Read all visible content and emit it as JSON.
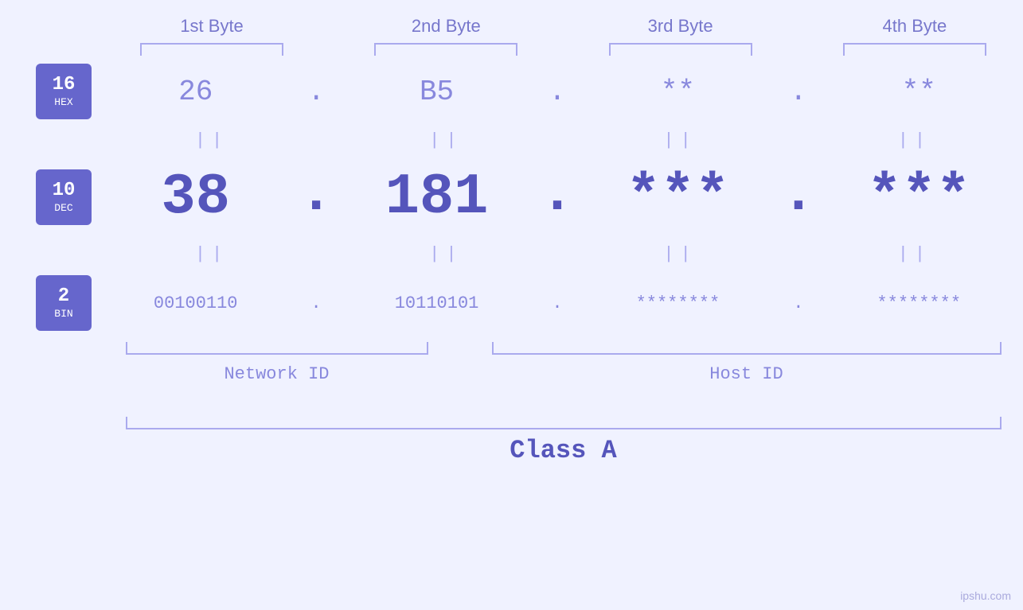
{
  "header": {
    "byte1": "1st Byte",
    "byte2": "2nd Byte",
    "byte3": "3rd Byte",
    "byte4": "4th Byte"
  },
  "badges": {
    "hex": {
      "num": "16",
      "label": "HEX"
    },
    "dec": {
      "num": "10",
      "label": "DEC"
    },
    "bin": {
      "num": "2",
      "label": "BIN"
    }
  },
  "hex_values": {
    "b1": "26",
    "b2": "B5",
    "b3": "**",
    "b4": "**"
  },
  "dec_values": {
    "b1": "38",
    "b2": "181",
    "b3": "***",
    "b4": "***"
  },
  "bin_values": {
    "b1": "00100110",
    "b2": "10110101",
    "b3": "********",
    "b4": "********"
  },
  "labels": {
    "network_id": "Network ID",
    "host_id": "Host ID",
    "class": "Class A"
  },
  "watermark": "ipshu.com"
}
